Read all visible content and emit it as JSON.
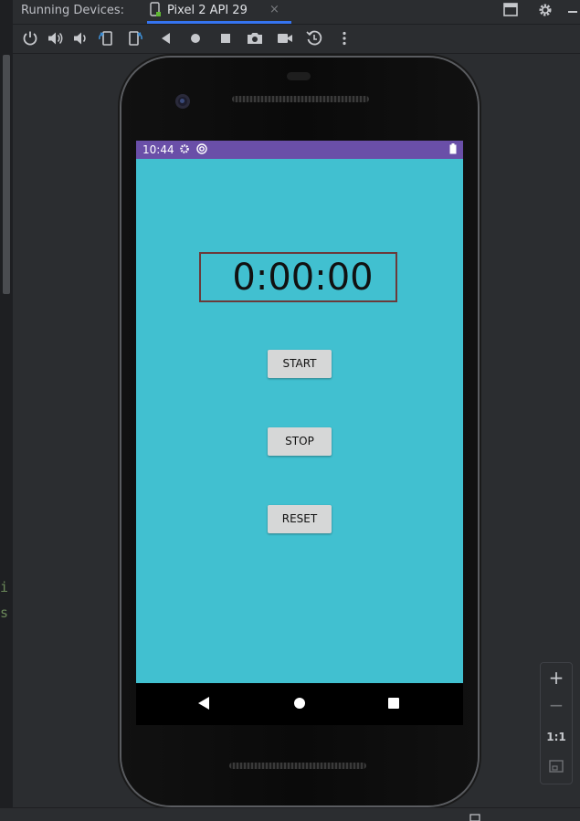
{
  "ide": {
    "panel_title": "Running Devices:",
    "device_tab": {
      "label": "Pixel 2 API 29",
      "close": "×"
    },
    "code_fragments": [
      "i",
      "s"
    ],
    "top_right_icons": [
      "window-icon",
      "gear-icon"
    ],
    "toolbar_icons": [
      "power-icon",
      "volume-up-icon",
      "volume-down-icon",
      "rotate-left-icon",
      "rotate-right-icon",
      "back-icon",
      "home-icon",
      "overview-icon",
      "screenshot-icon",
      "screen-record-icon",
      "snapshot-icon",
      "more-icon"
    ],
    "zoom": {
      "in": "+",
      "out": "−",
      "actual": "1:1"
    }
  },
  "device": {
    "status": {
      "time": "10:44"
    },
    "app": {
      "timer": "0:00:00",
      "buttons": {
        "start": "START",
        "stop": "STOP",
        "reset": "RESET"
      }
    },
    "colors": {
      "background": "#41c0d0",
      "status_bar": "#6a4fa8",
      "button": "#d6d7d7"
    }
  }
}
